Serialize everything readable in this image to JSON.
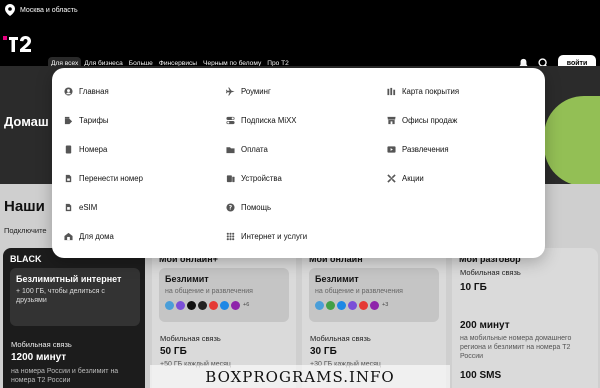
{
  "topbar": {
    "region": "Москва и область",
    "pin_icon": "location-pin-icon"
  },
  "header": {
    "logo_text": "t2",
    "nav": [
      "Для всех",
      "Для бизнеса",
      "Больше",
      "Финсервисы",
      "Черным по белому",
      "Про Т2"
    ],
    "active_nav": "Для всех",
    "login_label": "войти",
    "icons": [
      "bell-icon",
      "search-icon"
    ]
  },
  "page": {
    "hero_title": "Домаш",
    "section_title": "Наши",
    "section_sub": "Подключите"
  },
  "menu": {
    "columns": [
      [
        {
          "label": "Главная",
          "icon": "user-icon"
        },
        {
          "label": "Тарифы",
          "icon": "tariff-icon"
        },
        {
          "label": "Номера",
          "icon": "sim-number-icon"
        },
        {
          "label": "Перенести номер",
          "icon": "transfer-sim-icon"
        },
        {
          "label": "eSIM",
          "icon": "esim-icon"
        },
        {
          "label": "Для дома",
          "icon": "home-icon"
        }
      ],
      [
        {
          "label": "Роуминг",
          "icon": "plane-icon"
        },
        {
          "label": "Подписка MiXX",
          "icon": "toggle-icon"
        },
        {
          "label": "Оплата",
          "icon": "wallet-icon"
        },
        {
          "label": "Устройства",
          "icon": "phone-icon"
        },
        {
          "label": "Помощь",
          "icon": "help-icon"
        },
        {
          "label": "Интернет и услуги",
          "icon": "services-icon"
        }
      ],
      [
        {
          "label": "Карта покрытия",
          "icon": "coverage-bars-icon"
        },
        {
          "label": "Офисы продаж",
          "icon": "store-icon"
        },
        {
          "label": "Развлечения",
          "icon": "play-icon"
        },
        {
          "label": "Акции",
          "icon": "promo-icon"
        }
      ]
    ]
  },
  "cards": [
    {
      "name": "BLACK",
      "feature_title": "Безлимитный интернет",
      "feature_sub": "+ 100 ГБ, чтобы делиться с друзьями",
      "spec_label": "Мобильная связь",
      "spec_value": "1200 минут",
      "spec_note": "на номера России и безлимит на номера Т2 России"
    },
    {
      "name": "Мой онлайн+",
      "feature_title": "Безлимит",
      "feature_sub": "на общение и развлечения",
      "apps_more": "+6",
      "spec_label": "Мобильная связь",
      "spec_value": "50 ГБ",
      "spec_note": "+50 ГБ каждый месяц"
    },
    {
      "name": "Мой онлайн",
      "feature_title": "Безлимит",
      "feature_sub": "на общение и развлечения",
      "apps_more": "+3",
      "spec_label": "Мобильная связь",
      "spec_value": "30 ГБ",
      "spec_note": "+30 ГБ каждый месяц"
    },
    {
      "name": "Мой разговор",
      "spec_label": "Мобильная связь",
      "spec_value": "10 ГБ",
      "spec_value2": "200 минут",
      "spec_note2": "на мобильные номера домашнего региона и безлимит на номера Т2 России",
      "spec_value3": "100 SMS"
    }
  ],
  "watermark": "BOXPROGRAMS.INFO",
  "colors": {
    "accent": "#e4007e",
    "lime": "#9fcf5a",
    "black": "#000000"
  }
}
